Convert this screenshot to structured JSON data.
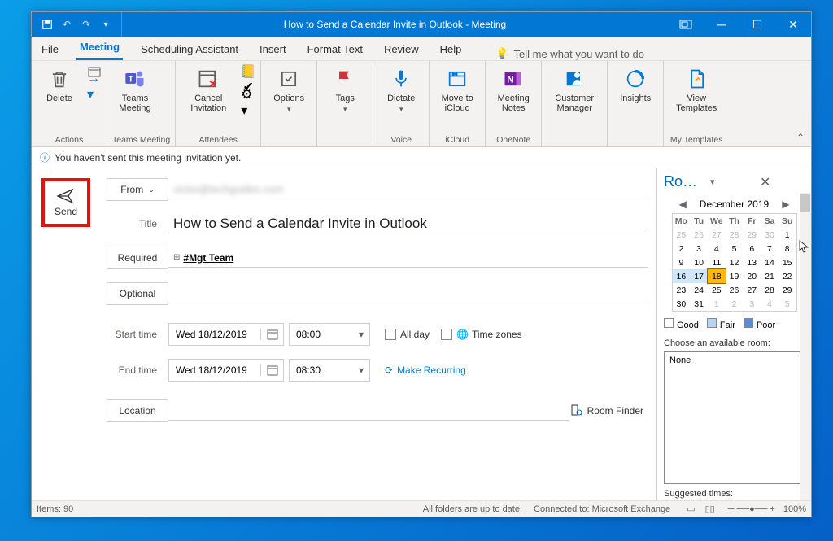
{
  "titlebar": {
    "title": "How to Send a Calendar Invite in Outlook  -  Meeting"
  },
  "menu": {
    "items": [
      "File",
      "Meeting",
      "Scheduling Assistant",
      "Insert",
      "Format Text",
      "Review",
      "Help"
    ],
    "active_index": 1,
    "tell_me": "Tell me what you want to do"
  },
  "ribbon": {
    "groups": {
      "actions": {
        "label": "Actions",
        "delete": "Delete"
      },
      "teams": {
        "label": "Teams Meeting",
        "button": "Teams Meeting"
      },
      "attendees": {
        "label": "Attendees",
        "cancel": "Cancel Invitation"
      },
      "options": {
        "label": "",
        "button": "Options"
      },
      "tags": {
        "label": "",
        "button": "Tags"
      },
      "voice": {
        "label": "Voice",
        "button": "Dictate"
      },
      "icloud": {
        "label": "iCloud",
        "button": "Move to iCloud"
      },
      "onenote": {
        "label": "OneNote",
        "button": "Meeting Notes"
      },
      "customer": {
        "label": "",
        "button": "Customer Manager"
      },
      "insights": {
        "label": "",
        "button": "Insights"
      },
      "templates": {
        "label": "My Templates",
        "button": "View Templates"
      }
    }
  },
  "infobar": {
    "text": "You haven't sent this meeting invitation yet."
  },
  "form": {
    "send": "Send",
    "from_label": "From",
    "from_value": "victor@techguides.com",
    "title_label": "Title",
    "title_value": "How to Send a Calendar Invite in Outlook",
    "required_label": "Required",
    "required_value": "#Mgt Team",
    "optional_label": "Optional",
    "start_label": "Start time",
    "end_label": "End time",
    "start_date": "Wed 18/12/2019",
    "end_date": "Wed 18/12/2019",
    "start_time": "08:00",
    "end_time": "08:30",
    "all_day": "All day",
    "time_zones": "Time zones",
    "make_recurring": "Make Recurring",
    "location_label": "Location",
    "room_finder": "Room Finder"
  },
  "panel": {
    "title": "Room Fin…",
    "month": "December 2019",
    "day_headers": [
      "Mo",
      "Tu",
      "We",
      "Th",
      "Fr",
      "Sa",
      "Su"
    ],
    "weeks": [
      [
        {
          "d": "25",
          "dim": true
        },
        {
          "d": "26",
          "dim": true
        },
        {
          "d": "27",
          "dim": true
        },
        {
          "d": "28",
          "dim": true
        },
        {
          "d": "29",
          "dim": true
        },
        {
          "d": "30",
          "dim": true
        },
        {
          "d": "1"
        }
      ],
      [
        {
          "d": "2"
        },
        {
          "d": "3"
        },
        {
          "d": "4"
        },
        {
          "d": "5"
        },
        {
          "d": "6"
        },
        {
          "d": "7"
        },
        {
          "d": "8"
        }
      ],
      [
        {
          "d": "9"
        },
        {
          "d": "10"
        },
        {
          "d": "11"
        },
        {
          "d": "12"
        },
        {
          "d": "13"
        },
        {
          "d": "14"
        },
        {
          "d": "15"
        }
      ],
      [
        {
          "d": "16",
          "r": true
        },
        {
          "d": "17",
          "r": true
        },
        {
          "d": "18",
          "sel": true
        },
        {
          "d": "19"
        },
        {
          "d": "20"
        },
        {
          "d": "21"
        },
        {
          "d": "22"
        }
      ],
      [
        {
          "d": "23"
        },
        {
          "d": "24"
        },
        {
          "d": "25"
        },
        {
          "d": "26"
        },
        {
          "d": "27"
        },
        {
          "d": "28"
        },
        {
          "d": "29"
        }
      ],
      [
        {
          "d": "30"
        },
        {
          "d": "31"
        },
        {
          "d": "1",
          "dim": true
        },
        {
          "d": "2",
          "dim": true
        },
        {
          "d": "3",
          "dim": true
        },
        {
          "d": "4",
          "dim": true
        },
        {
          "d": "5",
          "dim": true
        }
      ]
    ],
    "legend": {
      "good": "Good",
      "fair": "Fair",
      "poor": "Poor"
    },
    "choose_label": "Choose an available room:",
    "choose_value": "None",
    "suggested_label": "Suggested times:"
  },
  "status": {
    "items": "Items: 90",
    "folders": "All folders are up to date.",
    "connected": "Connected to: Microsoft Exchange",
    "zoom": "100%"
  }
}
